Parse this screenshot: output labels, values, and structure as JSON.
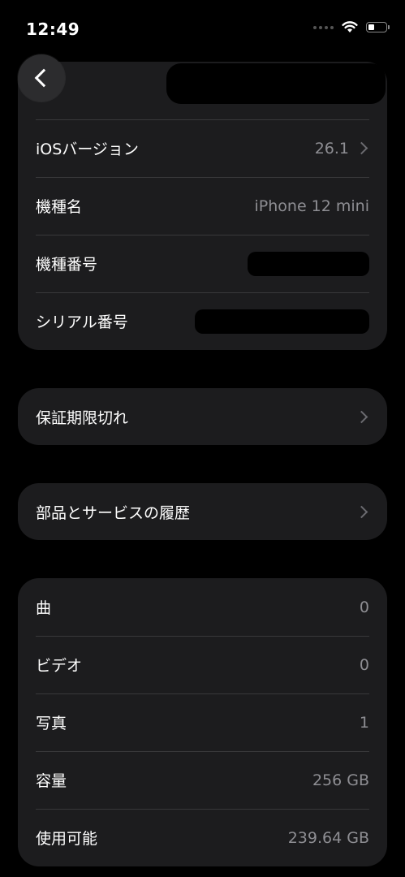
{
  "status_bar": {
    "time": "12:49",
    "battery_level": 0.35
  },
  "nav": {
    "back_icon": "chevron-left-icon"
  },
  "device_info": [
    {
      "label": "iOSバージョン",
      "value": "26.1",
      "chevron": true
    },
    {
      "label": "機種名",
      "value": "iPhone 12 mini",
      "chevron": false
    },
    {
      "label": "機種番号",
      "value": "",
      "chevron": false,
      "redacted": true
    },
    {
      "label": "シリアル番号",
      "value": "",
      "chevron": false,
      "redacted": true
    }
  ],
  "warranty": {
    "label": "保証期限切れ"
  },
  "parts_history": {
    "label": "部品とサービスの履歴"
  },
  "media_info": [
    {
      "label": "曲",
      "value": "0"
    },
    {
      "label": "ビデオ",
      "value": "0"
    },
    {
      "label": "写真",
      "value": "1"
    },
    {
      "label": "容量",
      "value": "256 GB"
    },
    {
      "label": "使用可能",
      "value": "239.64 GB"
    }
  ]
}
